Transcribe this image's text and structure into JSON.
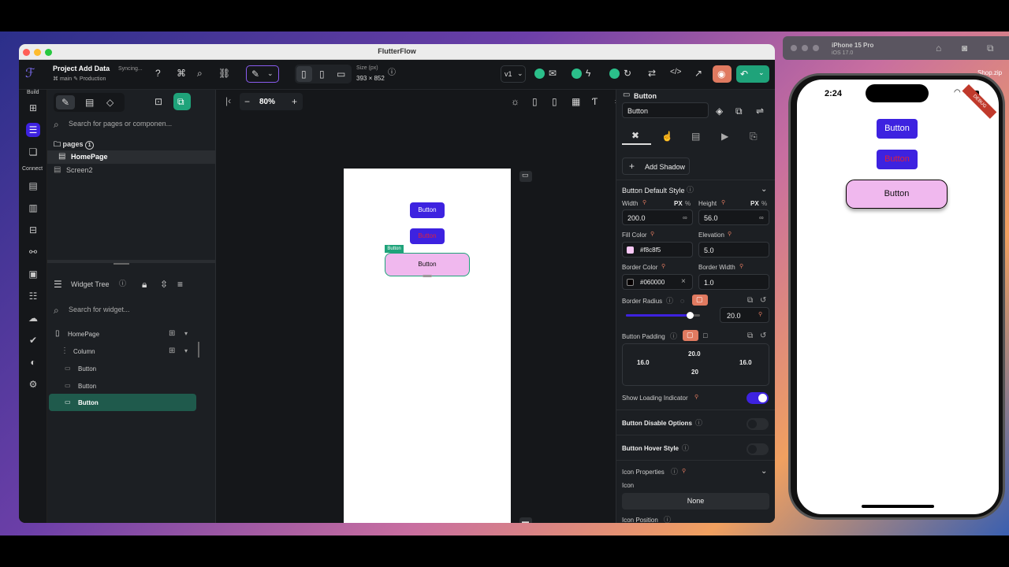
{
  "app_title": "FlutterFlow",
  "project": {
    "name": "Project Add Data",
    "sync_status": "Syncing...",
    "branch": "main",
    "env": "Production"
  },
  "toolbar": {
    "size_label": "Size (px)",
    "size_value": "393 × 852",
    "version": "v1",
    "zoom": "80%"
  },
  "left_rail": {
    "build_label": "Build",
    "connect_label": "Connect"
  },
  "pages_panel": {
    "search_placeholder": "Search for pages or componen...",
    "section_label": "pages",
    "section_count": "1",
    "pages": [
      "HomePage",
      "Screen2"
    ]
  },
  "widget_tree": {
    "title": "Widget Tree",
    "search_placeholder": "Search for widget...",
    "nodes": [
      "HomePage",
      "Column",
      "Button",
      "Button",
      "Button"
    ]
  },
  "canvas": {
    "buttons": [
      "Button",
      "Button",
      "Button"
    ],
    "selected_tag": "Button"
  },
  "props": {
    "widget_type": "Button",
    "widget_name": "Button",
    "add_shadow": "Add Shadow",
    "section_title": "Button Default Style",
    "width_label": "Width",
    "width_value": "200.0",
    "width_unit": "PX",
    "height_label": "Height",
    "height_value": "56.0",
    "height_unit": "PX",
    "pct": "%",
    "inf": "∞",
    "fill_label": "Fill Color",
    "fill_value": "#f8c8f5",
    "elevation_label": "Elevation",
    "elevation_value": "5.0",
    "border_color_label": "Border Color",
    "border_color_value": "#060000",
    "border_width_label": "Border Width",
    "border_width_value": "1.0",
    "radius_label": "Border Radius",
    "radius_value": "20.0",
    "radius_fraction": 0.86,
    "padding_label": "Button Padding",
    "padding_top": "20.0",
    "padding_bottom": "20",
    "padding_left": "16.0",
    "padding_right": "16.0",
    "loading_label": "Show Loading Indicator",
    "disable_label": "Button Disable Options",
    "hover_label": "Button Hover Style",
    "icon_props_label": "Icon Properties",
    "icon_label": "Icon",
    "icon_value": "None",
    "icon_position_label": "Icon Position"
  },
  "simulator": {
    "device": "iPhone 15 Pro",
    "os": "iOS 17.0",
    "time": "2:24",
    "debug_badge": "DEBUG",
    "buttons": [
      "Button",
      "Button",
      "Button"
    ],
    "desktop_label": "Shop.zip"
  },
  "colors": {
    "accent": "#3d22e0",
    "pink": "#f0b8ee",
    "red_text": "#e0203a",
    "green": "#1fa37a"
  }
}
